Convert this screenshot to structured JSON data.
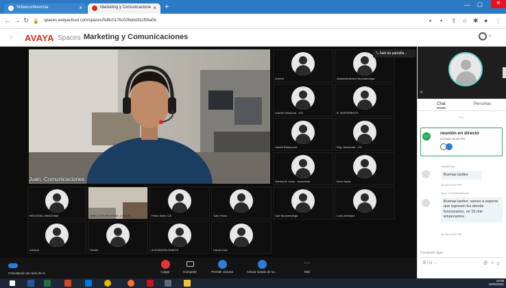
{
  "browser": {
    "tab1": {
      "title": "Videoconferencia"
    },
    "tab2": {
      "title": "Marketing y Comunicacione"
    },
    "url": "spaces.avayacloud.com/spaces/5d9c0176c026ebd31cf59a0b"
  },
  "app": {
    "brand": "AVAYA",
    "product": "Spaces",
    "room_title": "Marketing y Comunicaciones",
    "user_initial": "lv"
  },
  "stage": {
    "main_speaker": "Juan -Comunicaciones",
    "exit_fullscreen": "Salir de pantalla...",
    "right_tiles": [
      "Lizbeth",
      "Abastecimientos Bucaramanga",
      "Lizbeth Sandoval - OCI",
      "B. NORORIENTE",
      "Yamile Betancourt",
      "Reg. Amazonia - TIC",
      "Sandra M. Cano - Nororiente",
      "Dora Tacha",
      "Caé Bucaramanga",
      "Lucio Arbelaez"
    ],
    "bottom_row1": [
      "REGIONAL AMAZONIA",
      "DIRECTOR REGIONAL LLANOS",
      "Pedro Nieto 125",
      "Tulio Pardo"
    ],
    "bottom_row2": [
      "Adriana",
      "Yaneth",
      "ALEJANDRA RAMOS",
      "Harold Diaz"
    ]
  },
  "toolbar": {
    "noise_cancel": "Cancelación de ruido de IA",
    "hang_up": "Colgar",
    "share": "Compartir",
    "camera": "Permitir cámara",
    "audio": "Activar sonido de su...",
    "more": "Más"
  },
  "sidebar": {
    "self_label": "lv",
    "tab_chat": "Chat",
    "tab_people": "Personas",
    "day": "Hoy",
    "meeting_title": "reunión en directo",
    "meeting_sub": "Iniciada 15:26 PM",
    "messages": [
      {
        "author": "Harold Diaz",
        "text": "Buenas tardes",
        "time": "16 Jun 21:57 PM"
      },
      {
        "author": "Juan -Comunicaciones",
        "text": "Buenas tardes, vamos a esperar que ingresen los demás funcionarios, en 10 min empezamos",
        "time": "16 Jun 22:02 PM"
      }
    ],
    "compose_placeholder": "Compartir algo",
    "fmt": "B  I  U  ..."
  },
  "taskbar": {
    "time": "14:09",
    "date": "16/06/2021"
  },
  "colors": {
    "brand_red": "#da291c",
    "browser_blue": "#2c79c4",
    "accent_teal": "#5ed3c9",
    "live_green": "#29a35a",
    "hangup_red": "#e0353a",
    "toolbar_blue": "#2f7bd8"
  }
}
